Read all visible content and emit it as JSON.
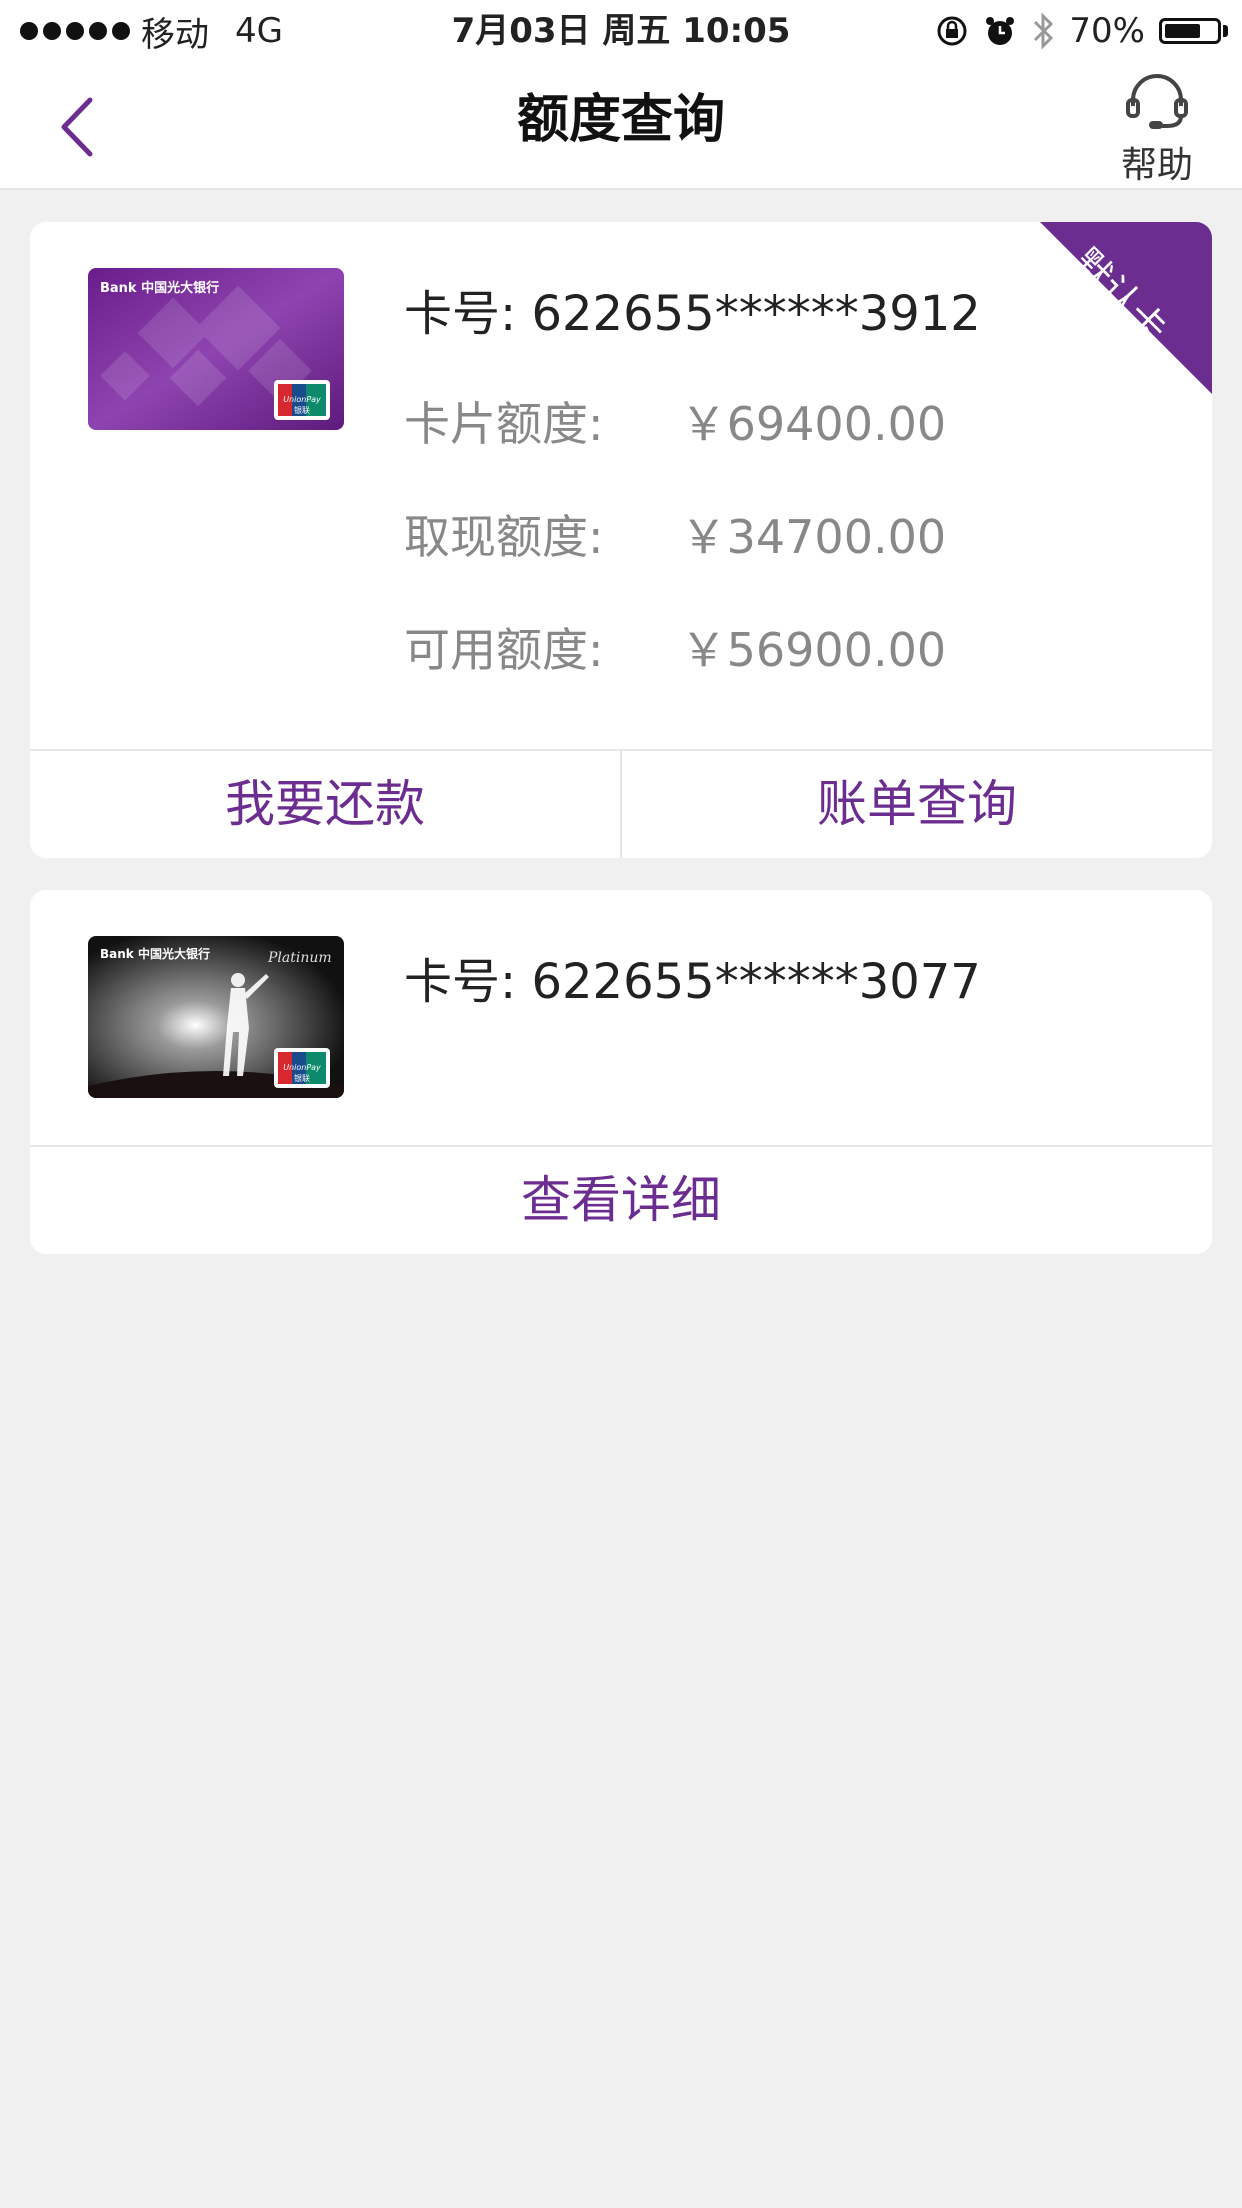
{
  "status_bar": {
    "carrier": "移动",
    "network": "4G",
    "datetime": "7月03日 周五 10:05",
    "battery": "70%",
    "battery_level": 0.7
  },
  "nav": {
    "title": "额度查询",
    "back_icon": "chevron-left-icon",
    "help_label": "帮助",
    "help_icon": "headset-icon"
  },
  "cards": [
    {
      "number_label": "卡号:",
      "number": "622655******3912",
      "badge": "默认卡",
      "card_logo_text": "Bank 中国光大银行",
      "unionpay_text": "UnionPay 银联",
      "limits": [
        {
          "label": "卡片额度:",
          "value": "￥69400.00"
        },
        {
          "label": "取现额度:",
          "value": "￥34700.00"
        },
        {
          "label": "可用额度:",
          "value": "￥56900.00"
        }
      ],
      "actions": [
        "我要还款",
        "账单查询"
      ]
    },
    {
      "number_label": "卡号:",
      "number": "622655******3077",
      "card_logo_text": "Bank 中国光大银行",
      "card_tier_text": "Platinum",
      "unionpay_text": "UnionPay 银联",
      "actions": [
        "查看详细"
      ]
    }
  ],
  "colors": {
    "accent": "#6c2d91",
    "background": "#f0f0f0"
  }
}
